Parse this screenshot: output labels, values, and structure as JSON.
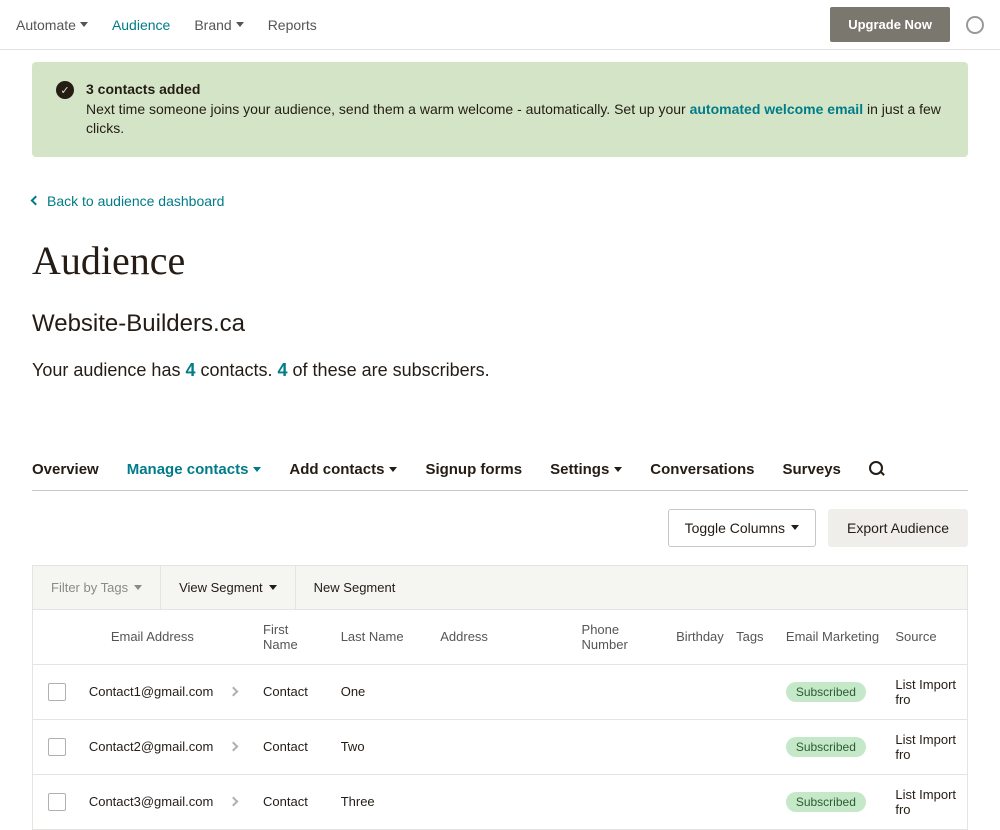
{
  "topnav": {
    "items": [
      {
        "label": "Automate",
        "caret": true
      },
      {
        "label": "Audience",
        "caret": false,
        "active": true
      },
      {
        "label": "Brand",
        "caret": true
      },
      {
        "label": "Reports",
        "caret": false
      }
    ],
    "upgrade_label": "Upgrade Now"
  },
  "notice": {
    "title": "3 contacts added",
    "text_before": "Next time someone joins your audience, send them a warm welcome - automatically. Set up your ",
    "link_text": "automated welcome email",
    "text_after": " in just a few clicks."
  },
  "backlink": {
    "label": "Back to audience dashboard"
  },
  "page": {
    "title": "Audience",
    "subtitle": "Website-Builders.ca",
    "stats_prefix": "Your audience has ",
    "count1": "4",
    "stats_mid": " contacts. ",
    "count2": "4",
    "stats_suffix": " of these are subscribers."
  },
  "tabs": [
    {
      "label": "Overview"
    },
    {
      "label": "Manage contacts",
      "caret": true,
      "active": true
    },
    {
      "label": "Add contacts",
      "caret": true
    },
    {
      "label": "Signup forms"
    },
    {
      "label": "Settings",
      "caret": true
    },
    {
      "label": "Conversations"
    },
    {
      "label": "Surveys"
    }
  ],
  "toolbar": {
    "toggle_columns": "Toggle Columns",
    "export": "Export Audience"
  },
  "filterbar": {
    "tags": "Filter by Tags",
    "view_segment": "View Segment",
    "new_segment": "New Segment"
  },
  "columns": {
    "email": "Email Address",
    "first": "First Name",
    "last": "Last Name",
    "address": "Address",
    "phone": "Phone Number",
    "birthday": "Birthday",
    "tags": "Tags",
    "email_marketing": "Email Marketing",
    "source": "Source"
  },
  "rows": [
    {
      "email": "Contact1@gmail.com",
      "first": "Contact",
      "last": "One",
      "status": "Subscribed",
      "source": "List Import fro"
    },
    {
      "email": "Contact2@gmail.com",
      "first": "Contact",
      "last": "Two",
      "status": "Subscribed",
      "source": "List Import fro"
    },
    {
      "email": "Contact3@gmail.com",
      "first": "Contact",
      "last": "Three",
      "status": "Subscribed",
      "source": "List Import fro"
    }
  ]
}
